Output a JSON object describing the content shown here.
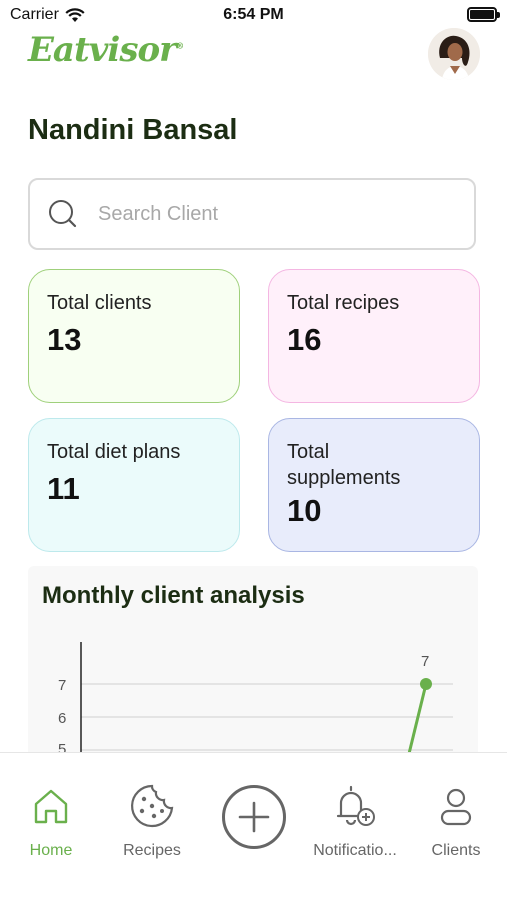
{
  "status_bar": {
    "carrier": "Carrier",
    "time": "6:54 PM"
  },
  "header": {
    "logo_text": "Eatvisor",
    "logo_mark": "®",
    "brand_color": "#6ab04c"
  },
  "user": {
    "name": "Nandini Bansal"
  },
  "search": {
    "placeholder": "Search Client",
    "value": ""
  },
  "stats": [
    {
      "label": "Total clients",
      "value": "13",
      "bg": "#f8fff2",
      "border": "#9fd07b"
    },
    {
      "label": "Total recipes",
      "value": "16",
      "bg": "#fff0fa",
      "border": "#f4b6e2"
    },
    {
      "label": "Total diet plans",
      "value": "11",
      "bg": "#ebfbfb",
      "border": "#bde9ec"
    },
    {
      "label": "Total supplements",
      "value": "10",
      "bg": "#e8ecfb",
      "border": "#a9b6e3"
    }
  ],
  "chart_panel": {
    "title": "Monthly client analysis"
  },
  "chart_data": {
    "type": "line",
    "title": "Monthly client analysis",
    "y_ticks": [
      "7",
      "6",
      "5"
    ],
    "series": [
      {
        "values": [
          7
        ],
        "point_label": "7",
        "color": "#6ab04c"
      }
    ],
    "grid": true
  },
  "tabs": [
    {
      "label": "Home",
      "icon": "home-icon",
      "active": true
    },
    {
      "label": "Recipes",
      "icon": "cookie-icon",
      "active": false
    },
    {
      "label": "",
      "icon": "plus-circle-icon",
      "active": false
    },
    {
      "label": "Notificatio...",
      "icon": "bell-add-icon",
      "active": false
    },
    {
      "label": "Clients",
      "icon": "person-icon",
      "active": false
    }
  ],
  "colors": {
    "accent": "#6ab04c",
    "inactive_tab": "#666666",
    "title_text": "#1c2d13"
  }
}
